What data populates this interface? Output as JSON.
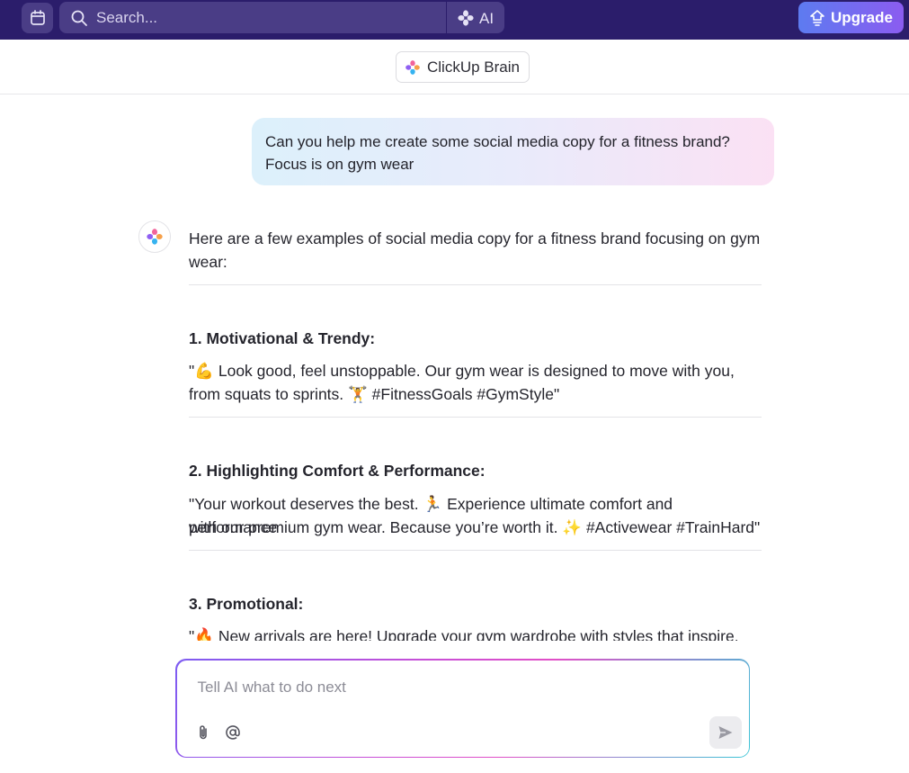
{
  "topbar": {
    "calendar_icon": "calendar-icon",
    "search_placeholder": "Search...",
    "ai_label": "AI",
    "upgrade_label": "Upgrade"
  },
  "header": {
    "title": "ClickUp Brain"
  },
  "conversation": {
    "user_message": {
      "line1": "Can you help me create some social media copy for a fitness brand?",
      "line2": "Focus is on gym wear"
    },
    "reply": {
      "intro_line1": "Here are a few examples of social media copy for a fitness brand focusing on gym",
      "intro_line2": "wear:",
      "sections": [
        {
          "heading": "1. Motivational & Trendy:",
          "line1": "\"💪 Look good, feel unstoppable. Our gym wear is designed to move with you,",
          "line2": "from squats to sprints. 🏋️ #FitnessGoals #GymStyle\""
        },
        {
          "heading": "2. Highlighting Comfort & Performance:",
          "line1": "\"Your workout deserves the best. 🏃 Experience ultimate comfort and performance",
          "line2": "with our premium gym wear. Because you’re worth it. ✨ #Activewear #TrainHard\""
        },
        {
          "heading": "3. Promotional:",
          "line1": "\"🔥 New arrivals are here! Upgrade your gym wardrobe with styles that inspire."
        }
      ]
    }
  },
  "composer": {
    "placeholder": "Tell AI what to do next"
  },
  "colors": {
    "topbar_bg": "#2b1d6b",
    "upgrade_gradient_start": "#5d7bf0",
    "upgrade_gradient_end": "#8b5cf0"
  }
}
